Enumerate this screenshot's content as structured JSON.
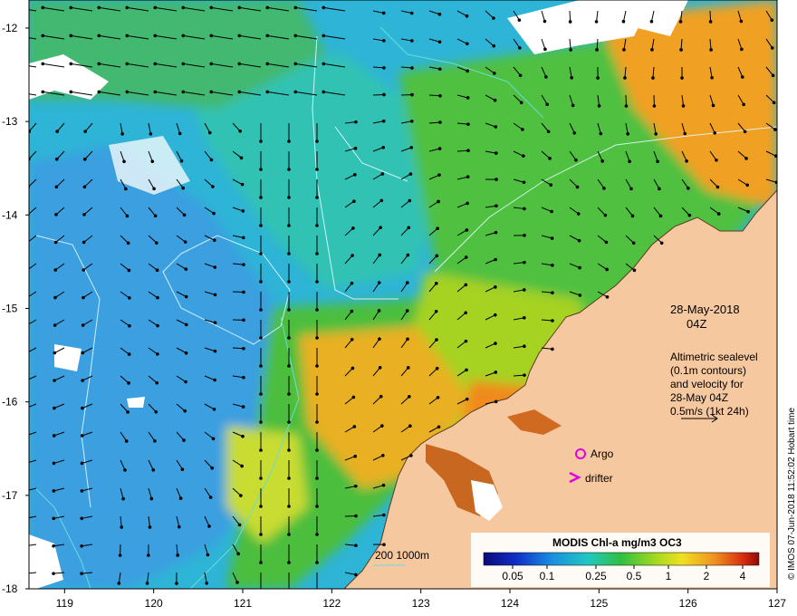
{
  "map": {
    "lon_ticks": [
      "119",
      "120",
      "121",
      "122",
      "123",
      "124",
      "125",
      "126",
      "127"
    ],
    "lat_ticks": [
      "-12",
      "-13",
      "-14",
      "-15",
      "-16",
      "-17",
      "-18"
    ],
    "lon_range": [
      118.6,
      127
    ],
    "lat_range": [
      -18,
      -11.7
    ]
  },
  "annotations": {
    "date": "28-May-2018",
    "time": "04Z",
    "legend_lines": [
      "Altimetric sealevel",
      "(0.1m contours)",
      "and velocity for",
      "28-May 04Z",
      "0.5m/s (1kt 24h)"
    ],
    "argo_label": "Argo",
    "drifter_label": "drifter",
    "depth_label": "200  1000m"
  },
  "colorbar": {
    "title": "MODIS Chl-a mg/m3 OC3",
    "ticks": [
      "0.05",
      "0.1",
      "0.25",
      "0.5",
      "1",
      "2",
      "4"
    ]
  },
  "credit": "© IMOS 07-Jun-2018 11:52:02 Hobart time",
  "colors": {
    "land": "#f6c8a0",
    "argo_marker": "#e000e0",
    "drifter_marker": "#e000e0",
    "contour_depth": "#66dddd"
  }
}
